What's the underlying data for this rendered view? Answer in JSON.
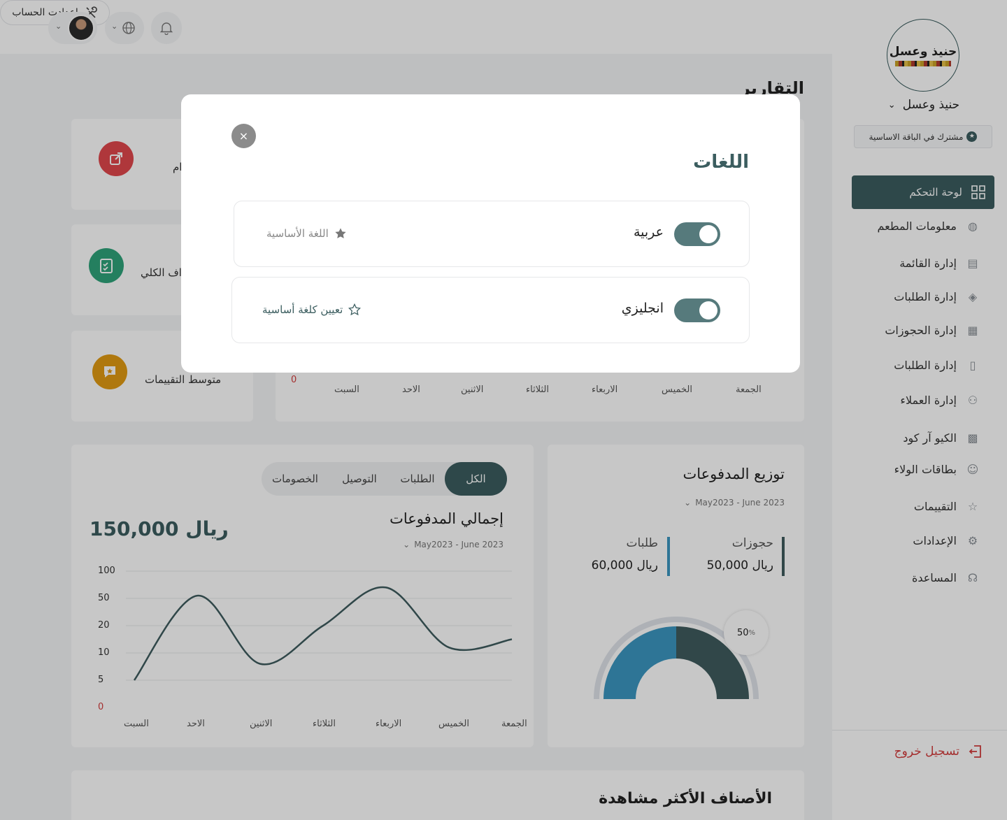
{
  "topbar": {
    "account_settings_label": "اعدادت الحساب"
  },
  "sidebar": {
    "logo_text": "حنيذ وعسل",
    "restaurant_name": "حنيذ وعسل",
    "subscription_badge": "مشترك في الباقة الاساسية",
    "active_item": "لوحة التحكم",
    "items": [
      {
        "label": "معلومات المطعم",
        "icon": "chef-icon"
      },
      {
        "label": "إدارة القائمة",
        "icon": "menu-icon"
      },
      {
        "label": "إدارة الطلبات",
        "icon": "layers-icon"
      },
      {
        "label": "إدارة الحجوزات",
        "icon": "calendar-icon"
      },
      {
        "label": "إدارة الطلبات",
        "icon": "clipboard-icon"
      },
      {
        "label": "إدارة العملاء",
        "icon": "users-icon"
      },
      {
        "label": "الكيو آر كود",
        "icon": "qr-icon"
      },
      {
        "label": "بطاقات الولاء",
        "icon": "smile-icon"
      },
      {
        "label": "التقييمات",
        "icon": "star-frame-icon"
      },
      {
        "label": "الإعدادات",
        "icon": "gear-icon"
      },
      {
        "label": "المساعدة",
        "icon": "headset-icon"
      }
    ],
    "logout_label": "تسجيل خروج"
  },
  "main": {
    "page_title": "التقارير",
    "stats": [
      {
        "label": "ام",
        "color": "#e0474c"
      },
      {
        "label": "اف الكلي",
        "color": "#2fa37a"
      },
      {
        "label": "متوسط التقييمات",
        "color": "#e19a12"
      }
    ],
    "weekly_axis": {
      "zero": "0",
      "days": [
        "السبت",
        "الاحد",
        "الاثنين",
        "الثلاثاء",
        "الاربعاء",
        "الخميس",
        "الجمعة"
      ]
    },
    "payments_total": {
      "tabs": [
        "الكل",
        "الطلبات",
        "التوصيل",
        "الخصومات"
      ],
      "active_tab": "الكل",
      "title": "إجمالي المدفوعات",
      "amount": "150,000 ريال",
      "date_range": "May2023 - June 2023"
    },
    "payments_distribution": {
      "title": "توزيع المدفوعات",
      "date_range": "May2023 - June 2023",
      "bookings_label": "حجوزات",
      "bookings_amount": "50,000 ريال",
      "orders_label": "طلبات",
      "orders_amount": "60,000 ريال",
      "percent_label": "50",
      "percent_sign": "%"
    },
    "most_viewed_title": "الأصناف الأكثر مشاهدة"
  },
  "chart_data": [
    {
      "type": "line",
      "title": "إجمالي المدفوعات",
      "categories": [
        "السبت",
        "الاحد",
        "الاثنين",
        "الثلاثاء",
        "الاربعاء",
        "الخميس",
        "الجمعة"
      ],
      "y_ticks": [
        "0",
        "5",
        "10",
        "20",
        "50",
        "100"
      ],
      "values": [
        5,
        55,
        8,
        20,
        70,
        12,
        15
      ],
      "line_color": "#3e5c5e",
      "grid": true
    },
    {
      "type": "pie",
      "title": "توزيع المدفوعات",
      "series": [
        {
          "name": "حجوزات",
          "value": 50,
          "color": "#3f5c5e"
        },
        {
          "name": "طلبات",
          "value": 50,
          "color": "#3b97c1"
        }
      ]
    }
  ],
  "modal": {
    "close_label": "×",
    "title": "اللغات",
    "languages": [
      {
        "name": "عربية",
        "enabled": true,
        "action": "اللغة الأساسية",
        "is_primary": true
      },
      {
        "name": "انجليزي",
        "enabled": true,
        "action": "تعيين كلغة أساسية",
        "is_primary": false
      }
    ]
  }
}
